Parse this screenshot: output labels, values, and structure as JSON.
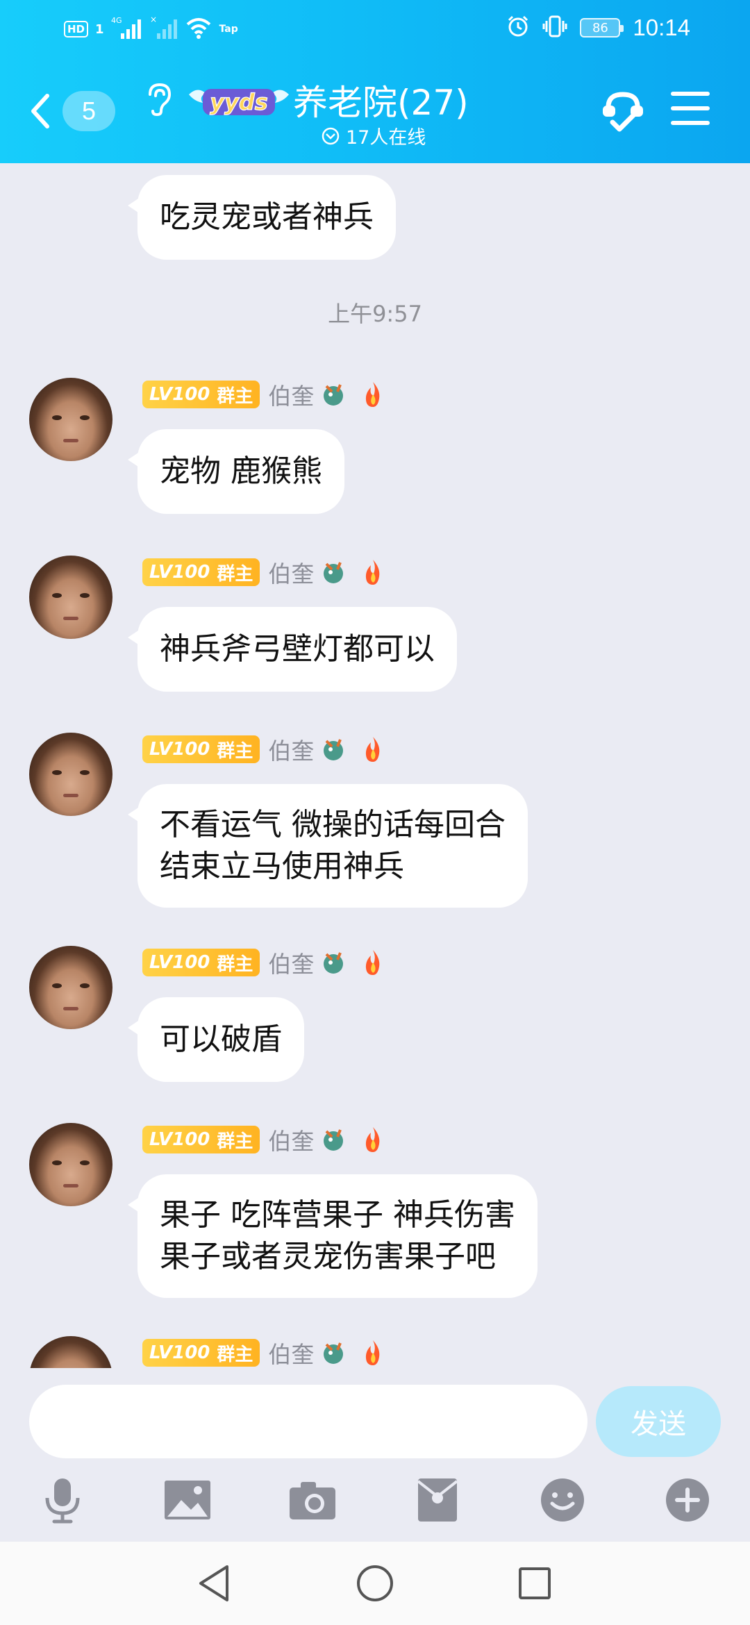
{
  "status_bar": {
    "hd": "HD",
    "sim1": "1",
    "network": "4G",
    "wifi_tag": "Tap",
    "battery": "86",
    "time": "10:14"
  },
  "header": {
    "back_count": "5",
    "title": "养老院(27)",
    "logo_text": "yyds",
    "online": "17人在线",
    "colors": {
      "accent": "#12c3f8",
      "accent_end": "#0ba6f0"
    }
  },
  "chat": {
    "partial_message": "吃灵宠或者神兵",
    "timestamp": "上午9:57",
    "messages": [
      {
        "level": "LV100",
        "role": "群主",
        "sender": "伯奎",
        "lines": [
          "宠物 鹿猴熊"
        ]
      },
      {
        "level": "LV100",
        "role": "群主",
        "sender": "伯奎",
        "lines": [
          "神兵斧弓壁灯都可以"
        ]
      },
      {
        "level": "LV100",
        "role": "群主",
        "sender": "伯奎",
        "lines": [
          "不看运气 微操的话每回合",
          "结束立马使用神兵"
        ]
      },
      {
        "level": "LV100",
        "role": "群主",
        "sender": "伯奎",
        "lines": [
          "可以破盾"
        ]
      },
      {
        "level": "LV100",
        "role": "群主",
        "sender": "伯奎",
        "lines": [
          "果子 吃阵营果子  神兵伤害",
          "果子或者灵宠伤害果子吧"
        ]
      },
      {
        "level": "LV100",
        "role": "群主",
        "sender": "伯奎",
        "lines": []
      }
    ]
  },
  "input": {
    "placeholder": "",
    "send_label": "发送"
  },
  "toolbar_icons": [
    "microphone-icon",
    "image-icon",
    "camera-icon",
    "red-packet-icon",
    "emoji-icon",
    "plus-icon"
  ],
  "nav_icons": [
    "back-triangle-icon",
    "home-circle-icon",
    "recents-square-icon"
  ]
}
